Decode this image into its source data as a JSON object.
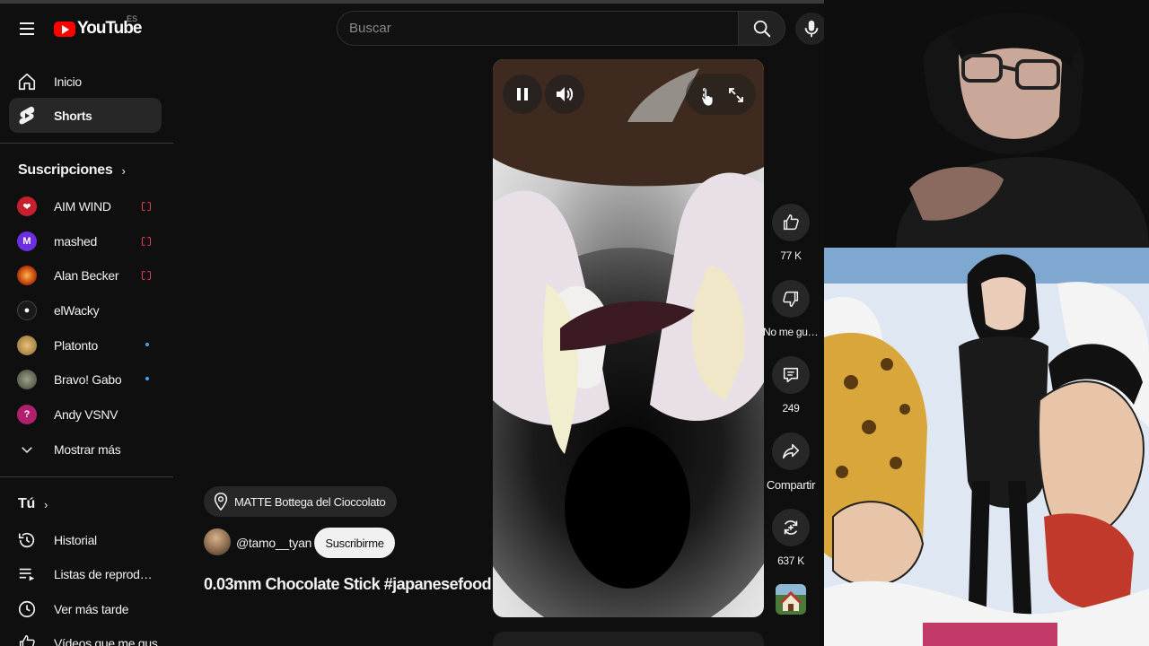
{
  "header": {
    "logo_text": "YouTube",
    "region": "ES",
    "search_placeholder": "Buscar"
  },
  "sidebar": {
    "main": [
      {
        "label": "Inicio",
        "icon": "home-icon"
      },
      {
        "label": "Shorts",
        "icon": "shorts-icon",
        "active": true
      }
    ],
    "subscriptions_title": "Suscripciones",
    "subscriptions": [
      {
        "label": "AIM WIND",
        "status": "live"
      },
      {
        "label": "mashed",
        "status": "live"
      },
      {
        "label": "Alan Becker",
        "status": "live"
      },
      {
        "label": "elWacky",
        "status": "none"
      },
      {
        "label": "Platonto",
        "status": "new"
      },
      {
        "label": "Bravo! Gabo",
        "status": "new"
      },
      {
        "label": "Andy VSNV",
        "status": "none"
      }
    ],
    "show_more": "Mostrar más",
    "you_title": "Tú",
    "you_items": [
      {
        "label": "Historial",
        "icon": "history-icon"
      },
      {
        "label": "Listas de reproducción",
        "icon": "playlists-icon"
      },
      {
        "label": "Ver más tarde",
        "icon": "watch-later-icon"
      },
      {
        "label": "Vídeos que me gus",
        "icon": "liked-icon"
      }
    ]
  },
  "short": {
    "location": "MATTE Bottega del Cioccolato",
    "channel": "@tamo__tyan",
    "subscribe_label": "Suscribirme",
    "title": "0.03mm Chocolate Stick #japanesefood"
  },
  "actions": {
    "likes": "77 K",
    "dislike_label": "No me gusta",
    "comments": "249",
    "share_label": "Compartir",
    "remixes": "637 K"
  },
  "colors": {
    "background": "#0f0f0f",
    "brand_red": "#ff0000",
    "chip": "#272727",
    "live": "#e04050",
    "new_dot": "#3ea6ff"
  }
}
